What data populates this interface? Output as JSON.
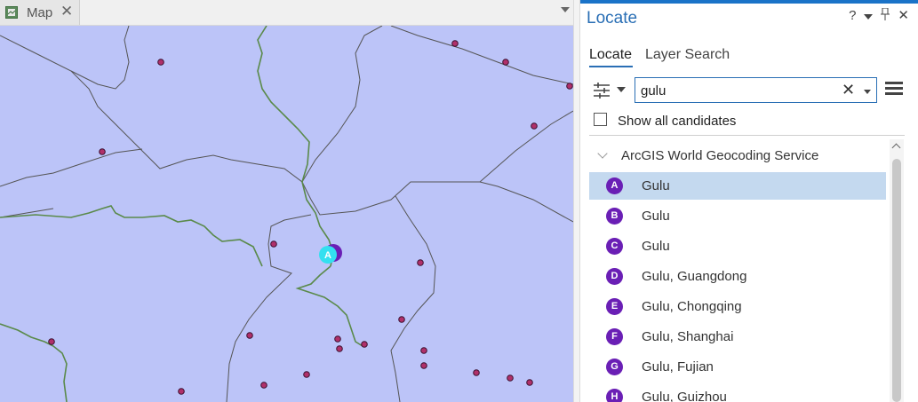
{
  "map": {
    "tab_label": "Map",
    "tab_close": "✕",
    "marker_letter": "A"
  },
  "pane": {
    "title": "Locate",
    "help": "?",
    "pin": "📌",
    "close": "✕",
    "tabs": {
      "locate": "Locate",
      "layer_search": "Layer Search"
    },
    "search": {
      "value": "gulu",
      "clear": "✕"
    },
    "show_all_candidates": "Show all candidates",
    "group": {
      "label": "ArcGIS World Geocoding Service"
    },
    "results": [
      {
        "letter": "A",
        "label": "Gulu",
        "selected": true
      },
      {
        "letter": "B",
        "label": "Gulu"
      },
      {
        "letter": "C",
        "label": "Gulu"
      },
      {
        "letter": "D",
        "label": "Gulu, Guangdong"
      },
      {
        "letter": "E",
        "label": "Gulu, Chongqing"
      },
      {
        "letter": "F",
        "label": "Gulu, Shanghai"
      },
      {
        "letter": "G",
        "label": "Gulu, Fujian"
      },
      {
        "letter": "H",
        "label": "Gulu, Guizhou"
      }
    ]
  },
  "colors": {
    "map_background": "#bcc4f8",
    "boundary": "#555555",
    "river": "#5a8a4a",
    "point_fill": "#b0306a",
    "marker": "#6a1fb5",
    "selected_row": "#c4d9ef",
    "accent": "#1a73c8"
  },
  "icons": {
    "map_tab": "map-document-icon",
    "options": "sliders-icon",
    "menu": "hamburger-menu-icon"
  }
}
